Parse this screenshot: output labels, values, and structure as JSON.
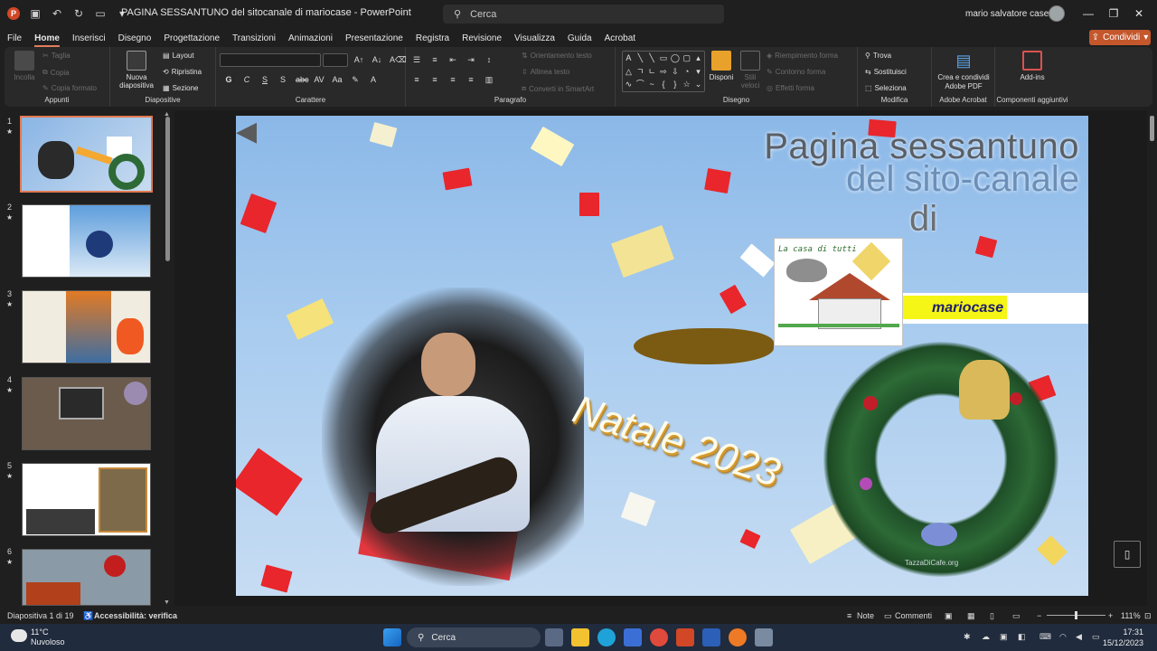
{
  "titlebar": {
    "doc_title": "PAGINA SESSANTUNO del sitocanale di mariocase  -  PowerPoint",
    "search_placeholder": "Cerca",
    "user": "mario salvatore casettari"
  },
  "menu": {
    "tabs": [
      "File",
      "Home",
      "Inserisci",
      "Disegno",
      "Progettazione",
      "Transizioni",
      "Animazioni",
      "Presentazione",
      "Registra",
      "Revisione",
      "Visualizza",
      "Guida",
      "Acrobat"
    ],
    "active_tab": "Home",
    "share": "Condividi"
  },
  "ribbon": {
    "clipboard": {
      "label": "Appunti",
      "paste": "Incolla",
      "cut": "Taglia",
      "copy": "Copia",
      "format_painter": "Copia formato"
    },
    "slides": {
      "label": "Diapositive",
      "new_slide": "Nuova diapositiva",
      "layout": "Layout",
      "reset": "Ripristina",
      "section": "Sezione"
    },
    "font": {
      "label": "Carattere",
      "font_name": "",
      "font_size": ""
    },
    "paragraph": {
      "label": "Paragrafo",
      "text_direction": "Orientamento testo",
      "align_text": "Allinea testo",
      "smartart": "Converti in SmartArt"
    },
    "drawing": {
      "label": "Disegno",
      "arrange": "Disponi",
      "quick_styles": "Stili veloci",
      "shape_fill": "Riempimento forma",
      "shape_outline": "Contorno forma",
      "shape_effects": "Effetti forma"
    },
    "editing": {
      "label": "Modifica",
      "find": "Trova",
      "replace": "Sostituisci",
      "select": "Seleziona"
    },
    "acrobat": {
      "label": "Adobe Acrobat",
      "create_share": "Crea e condividi Adobe PDF"
    },
    "addins": {
      "label": "Componenti aggiuntivi",
      "addins": "Add-ins"
    }
  },
  "thumbnails": [
    {
      "num": "1",
      "star": "★"
    },
    {
      "num": "2",
      "star": "★"
    },
    {
      "num": "3",
      "star": "★"
    },
    {
      "num": "4",
      "star": "★"
    },
    {
      "num": "5",
      "star": "★"
    },
    {
      "num": "6",
      "star": "★"
    }
  ],
  "slide": {
    "title_line1": "Pagina sessantuno",
    "title_line2": "del sito-canale",
    "title_line3": "di",
    "logo_text": "La casa di tutti",
    "name": "mariocase",
    "greeting": "Natale 2023",
    "watermark": "TazzaDiCafe.org"
  },
  "statusbar": {
    "slide_info": "Diapositiva 1 di 19",
    "accessibility": "Accessibilità: verifica",
    "notes": "Note",
    "comments": "Commenti",
    "zoom": "111%"
  },
  "taskbar": {
    "temp": "11°C",
    "condition": "Nuvoloso",
    "search": "Cerca",
    "time": "17:31",
    "date": "15/12/2023"
  },
  "colors": {
    "accent": "#c4572c",
    "selected_thumb": "#e07a52",
    "highlight": "#f5f516"
  }
}
